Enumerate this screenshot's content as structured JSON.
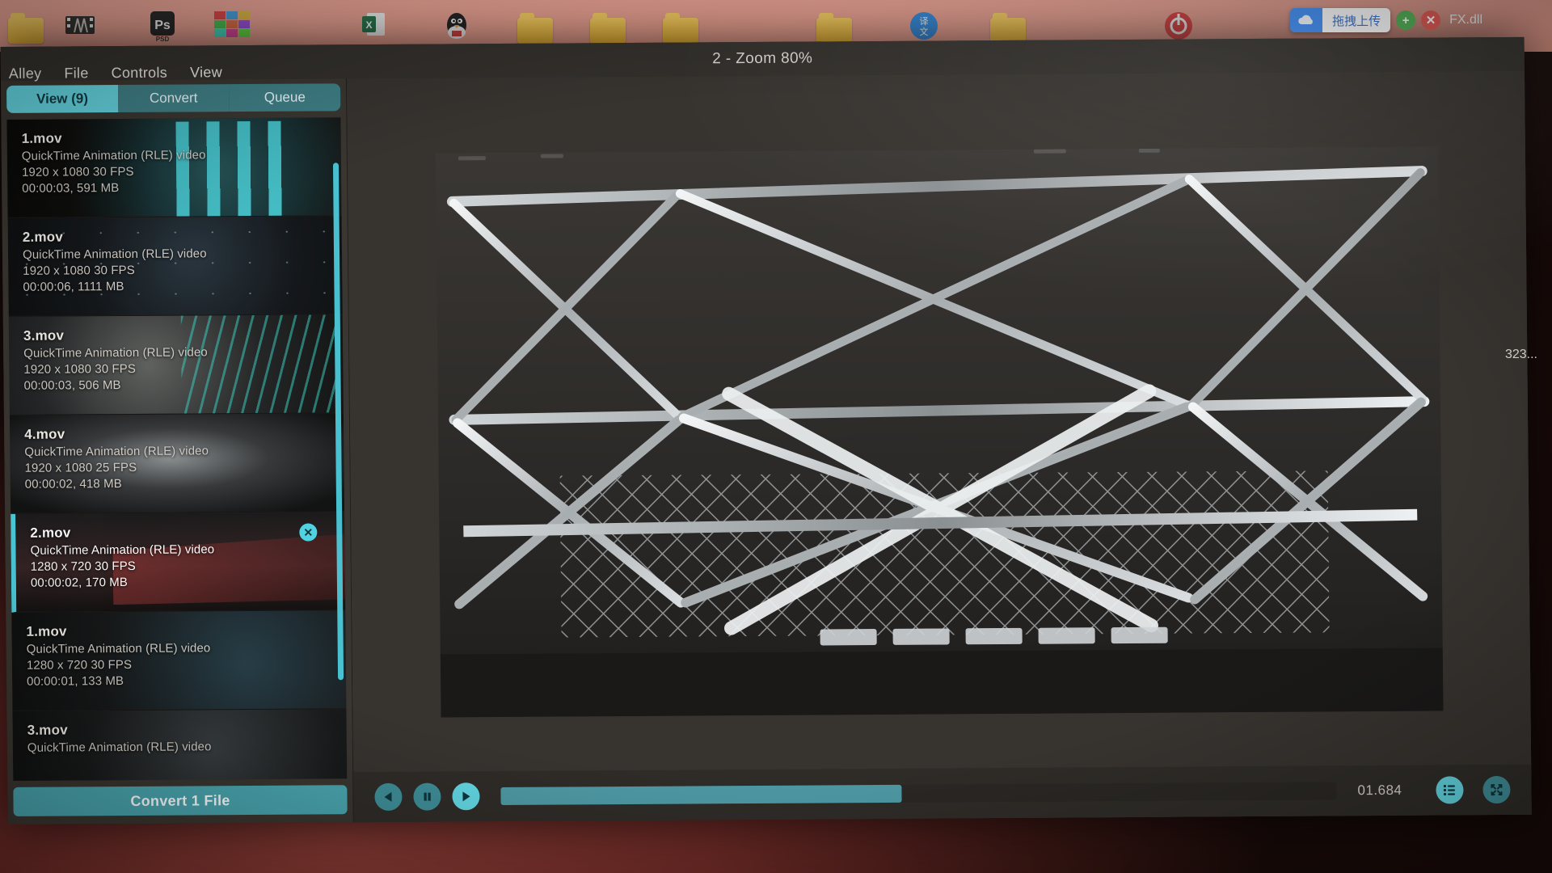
{
  "window": {
    "title": "2 - Zoom 80%"
  },
  "menu": {
    "items": [
      {
        "label": "Alley",
        "name": "menu-alley"
      },
      {
        "label": "File",
        "name": "menu-file"
      },
      {
        "label": "Controls",
        "name": "menu-controls"
      },
      {
        "label": "View",
        "name": "menu-view"
      }
    ]
  },
  "tabs": [
    {
      "label": "View (9)",
      "active": true
    },
    {
      "label": "Convert",
      "active": false
    },
    {
      "label": "Queue",
      "active": false
    }
  ],
  "files": [
    {
      "name": "1.mov",
      "format": "QuickTime Animation (RLE) video",
      "resolution": "1920 x 1080 30 FPS",
      "duration_size": "00:00:03, 591 MB",
      "selected": false
    },
    {
      "name": "2.mov",
      "format": "QuickTime Animation (RLE) video",
      "resolution": "1920 x 1080 30 FPS",
      "duration_size": "00:00:06, 1111 MB",
      "selected": false
    },
    {
      "name": "3.mov",
      "format": "QuickTime Animation (RLE) video",
      "resolution": "1920 x 1080 30 FPS",
      "duration_size": "00:00:03, 506 MB",
      "selected": false
    },
    {
      "name": "4.mov",
      "format": "QuickTime Animation (RLE) video",
      "resolution": "1920 x 1080 25 FPS",
      "duration_size": "00:00:02, 418 MB",
      "selected": false
    },
    {
      "name": "2.mov",
      "format": "QuickTime Animation (RLE) video",
      "resolution": "1280 x 720 30 FPS",
      "duration_size": "00:00:02, 170 MB",
      "selected": true,
      "remove_label": "✕"
    },
    {
      "name": "1.mov",
      "format": "QuickTime Animation (RLE) video",
      "resolution": "1280 x 720 30 FPS",
      "duration_size": "00:00:01, 133 MB",
      "selected": false
    },
    {
      "name": "3.mov",
      "format": "QuickTime Animation (RLE) video",
      "resolution": "",
      "duration_size": "",
      "selected": false
    }
  ],
  "actions": {
    "convert_label": "Convert 1 File"
  },
  "player": {
    "timecode": "01.684",
    "prev_icon": "previous-icon",
    "pause_icon": "pause-icon",
    "play_icon": "play-icon",
    "playlist_icon": "playlist-icon",
    "fullscreen_icon": "fullscreen-icon",
    "progress_percent": 48
  },
  "desktop": {
    "overlay_label": "拖拽上传",
    "overlay_filename": "FX.dll",
    "side_label": "323...",
    "add_icon": "plus-icon",
    "close_icon": "close-icon",
    "cloud_icon": "cloud-upload-icon"
  },
  "colors": {
    "accent": "#4fd3e3",
    "accent_dim": "#3f8e98",
    "panel": "#3a3631",
    "window": "#2f2b28",
    "text": "#e7e3dd"
  }
}
